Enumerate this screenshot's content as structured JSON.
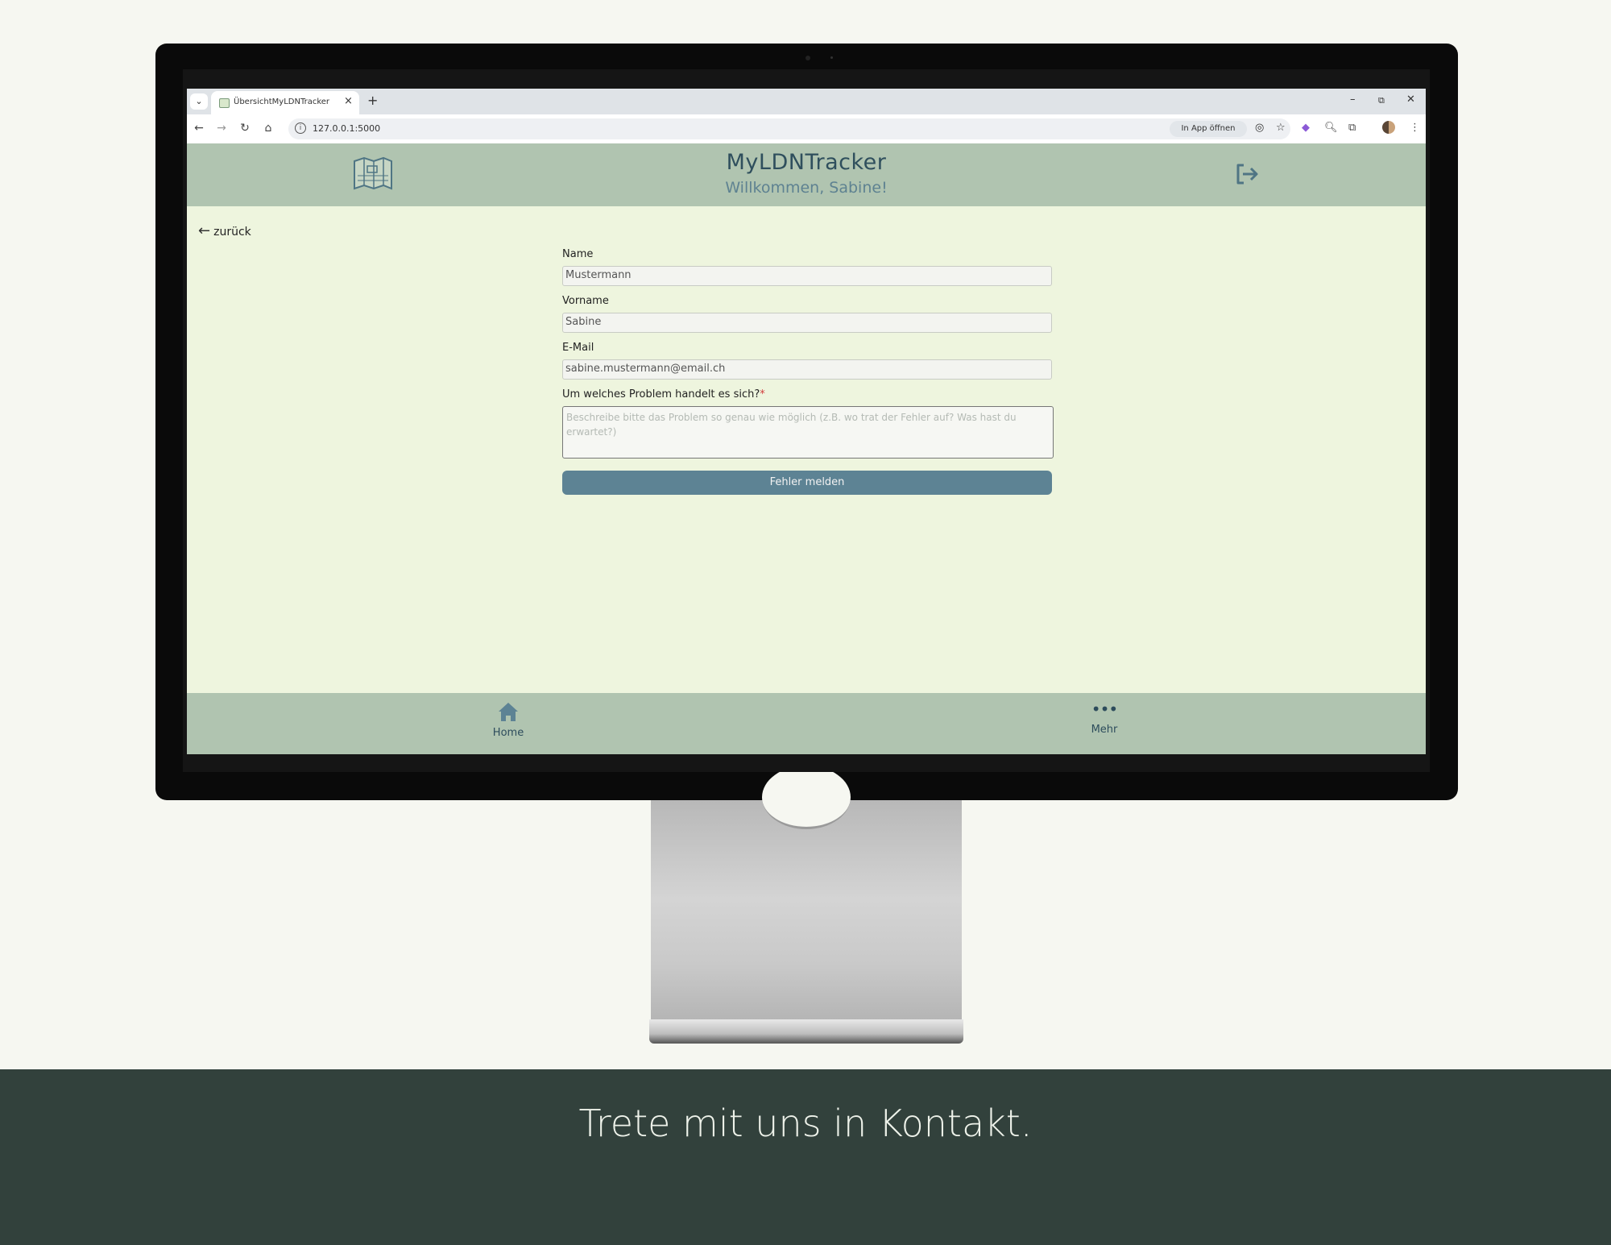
{
  "browser": {
    "tab_title": "ÜbersichtMyLDNTracker",
    "tab_close": "×",
    "new_tab": "+",
    "url": "127.0.0.1:5000",
    "in_app_label": "In App öffnen",
    "window_controls": {
      "minimize": "–",
      "restore": "⧉",
      "close": "✕"
    }
  },
  "header": {
    "title": "MyLDNTracker",
    "welcome": "Willkommen, Sabine!"
  },
  "back_label": "zurück",
  "form": {
    "name_label": "Name",
    "name_value": "Mustermann",
    "firstname_label": "Vorname",
    "firstname_value": "Sabine",
    "email_label": "E-Mail",
    "email_value": "sabine.mustermann@email.ch",
    "problem_label": "Um welches Problem handelt es sich?",
    "required_mark": "*",
    "problem_placeholder": "Beschreibe bitte das Problem so genau wie möglich (z.B. wo trat der Fehler auf? Was hast du erwartet?)",
    "submit_label": "Fehler melden"
  },
  "bottom_nav": {
    "home_label": "Home",
    "more_label": "Mehr"
  },
  "footer": {
    "tagline": "Trete mit uns in Kontakt."
  },
  "colors": {
    "header_bg": "#b0c4b0",
    "content_bg": "#eef5de",
    "button_bg": "#5d8394",
    "footer_bg": "#32413c"
  }
}
